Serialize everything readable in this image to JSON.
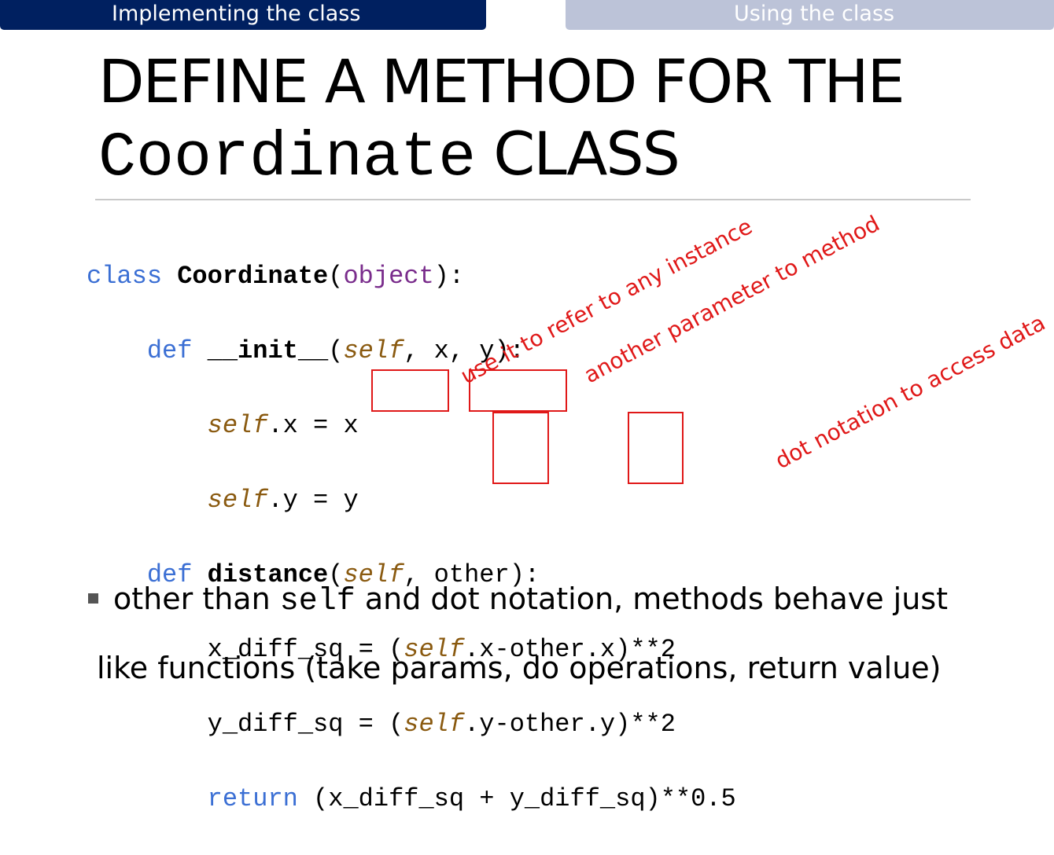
{
  "tabs": {
    "active": "Implementing the class",
    "inactive": "Using the class"
  },
  "title": {
    "line1": "DEFINE A METHOD FOR THE",
    "code_word": "Coordinate",
    "line2_rest": "CLASS"
  },
  "code": {
    "l1_class": "class",
    "l1_name": "Coordinate",
    "l1_open": "(",
    "l1_object": "object",
    "l1_close": "):",
    "l2_def": "def",
    "l2_init": "__init__",
    "l2_open": "(",
    "l2_self": "self",
    "l2_rest": ", x, y):",
    "l3_self": "self",
    "l3_rest": ".x = x",
    "l4_self": "self",
    "l4_rest": ".y = y",
    "l5_def": "def",
    "l5_name": "distance",
    "l5_open": "(",
    "l5_self": "self",
    "l5_rest": ", other):",
    "l6_a": "x_diff_sq = (",
    "l6_self": "self",
    "l6_b": ".x-other.x)**2",
    "l7_a": "y_diff_sq = (",
    "l7_self": "self",
    "l7_b": ".y-other.y)**2",
    "l8_return": "return",
    "l8_rest": " (x_diff_sq + y_diff_sq)**0.5"
  },
  "annotations": {
    "self_note": "use it to refer to any instance",
    "other_note": "another parameter to method",
    "dot_note": "dot notation to access data"
  },
  "body": {
    "line1_a": "other than ",
    "line1_code": "self",
    "line1_b": " and dot notation, methods behave just",
    "line2": "like functions (take params, do operations, return value)"
  },
  "colors": {
    "tab_active": "#002060",
    "tab_inactive": "#bcc3d8",
    "keyword": "#3b6fd4",
    "self": "#8a5a10",
    "object": "#7a2d8c",
    "annotation": "#e01818"
  }
}
